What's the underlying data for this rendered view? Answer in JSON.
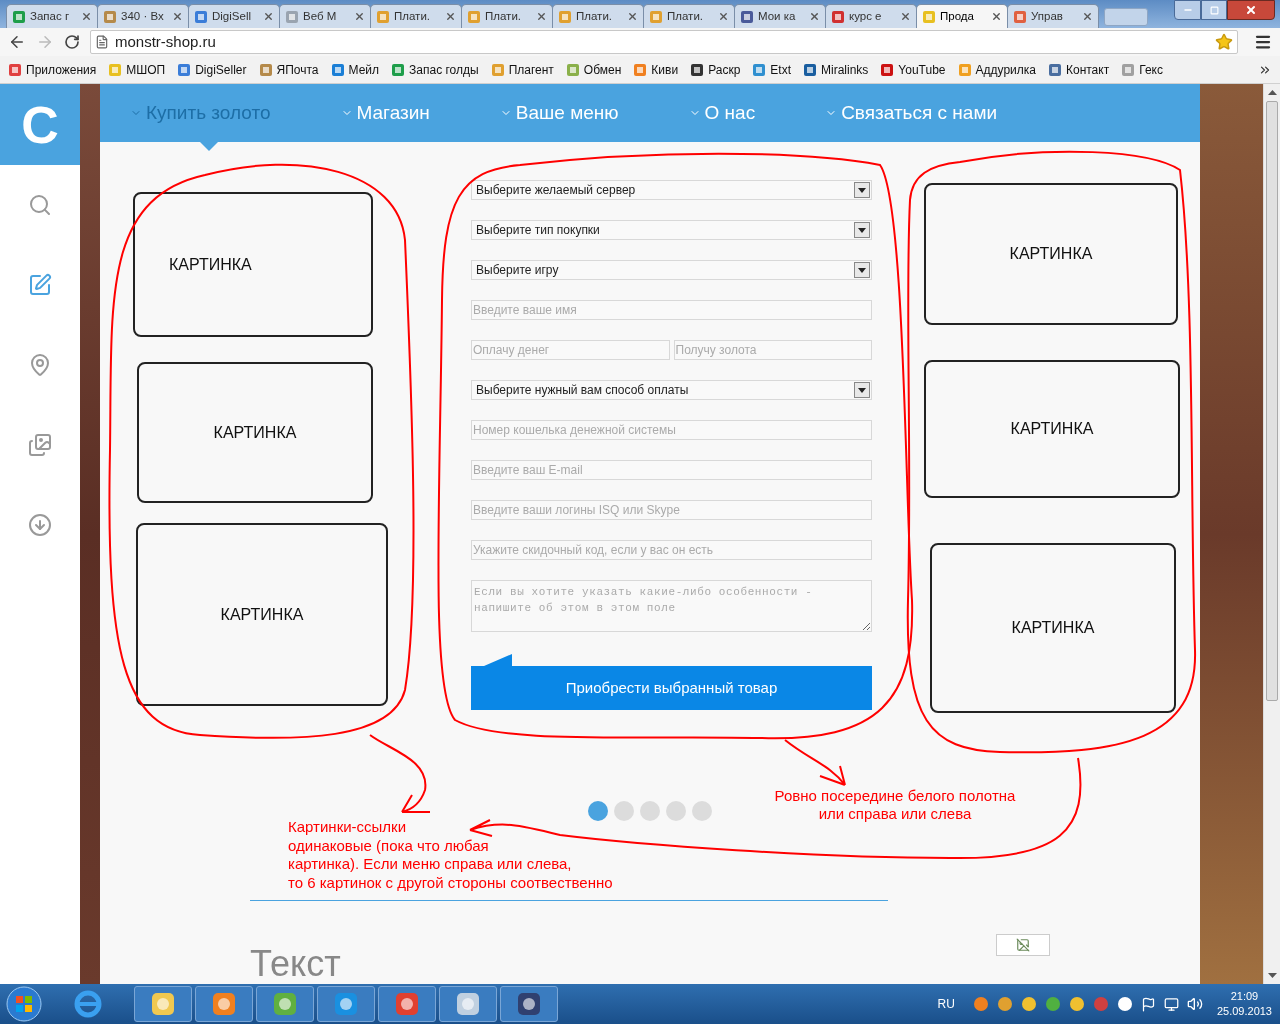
{
  "browser": {
    "tabs": [
      {
        "title": "Запас г",
        "selected": false
      },
      {
        "title": "340 · Вх",
        "selected": false
      },
      {
        "title": "DigiSell",
        "selected": false
      },
      {
        "title": "Веб М",
        "selected": false
      },
      {
        "title": "Плати.",
        "selected": false
      },
      {
        "title": "Плати.",
        "selected": false
      },
      {
        "title": "Плати.",
        "selected": false
      },
      {
        "title": "Плати.",
        "selected": false
      },
      {
        "title": "Мои ка",
        "selected": false
      },
      {
        "title": "курс е",
        "selected": false
      },
      {
        "title": "Прода",
        "selected": true
      },
      {
        "title": "Управ",
        "selected": false
      }
    ],
    "address": "monstr-shop.ru",
    "bookmarks": [
      "Приложения",
      "МШОП",
      "DigiSeller",
      "ЯПочта",
      "Мейл",
      "Запас голды",
      "Плагент",
      "Обмен",
      "Киви",
      "Раскр",
      "Etxt",
      "Miralinks",
      "YouTube",
      "Аддурилка",
      "Контакт",
      "Гекс"
    ]
  },
  "site": {
    "logo": "C",
    "nav": [
      {
        "label": "Купить золото",
        "selected": true
      },
      {
        "label": "Магазин",
        "selected": false
      },
      {
        "label": "Ваше меню",
        "selected": false
      },
      {
        "label": "О нас",
        "selected": false
      },
      {
        "label": "Связаться с нами",
        "selected": false
      }
    ],
    "left_cards": [
      "КАРТИНКА",
      "КАРТИНКА",
      "КАРТИНКА"
    ],
    "form": {
      "fields": [
        {
          "kind": "select",
          "value": "Выберите желаемый сервер"
        },
        {
          "kind": "select",
          "value": "Выберите тип покупки"
        },
        {
          "kind": "select",
          "value": "Выберите игру"
        },
        {
          "kind": "input",
          "placeholder": "Введите ваше имя"
        },
        {
          "kind": "pair",
          "placeholders": [
            "Оплачу денег",
            "Получу золота"
          ]
        },
        {
          "kind": "select",
          "value": "Выберите нужный вам способ оплаты"
        },
        {
          "kind": "input",
          "placeholder": "Номер кошелька денежной системы"
        },
        {
          "kind": "input",
          "placeholder": "Введите ваш E-mail"
        },
        {
          "kind": "input",
          "placeholder": "Введите ваши логины ISQ или Skype"
        },
        {
          "kind": "input",
          "placeholder": "Укажите скидочный код, если у вас он есть"
        },
        {
          "kind": "textarea",
          "placeholder": "Если вы хотите указать какие-либо особенности - напишите об этом в этом поле"
        }
      ],
      "submit": "Приобрести выбранный товар"
    },
    "right_cards": [
      "КАРТИНКА",
      "КАРТИНКА",
      "КАРТИНКА"
    ],
    "slider_dots": [
      {
        "selected": true
      },
      {
        "selected": false
      },
      {
        "selected": false
      },
      {
        "selected": false
      },
      {
        "selected": false
      }
    ],
    "notes": [
      "Картинки-ссылки\nодинаковые (пока что любая\n картинка). Если меню справа или слева,\nто 6 картинок с другой стороны соотвественно",
      "Ровно посередине белого полотна\nили справа или слева"
    ],
    "heading": "Текст"
  },
  "taskbar": {
    "language": "RU",
    "time": "21:09",
    "date": "25.09.2013"
  }
}
